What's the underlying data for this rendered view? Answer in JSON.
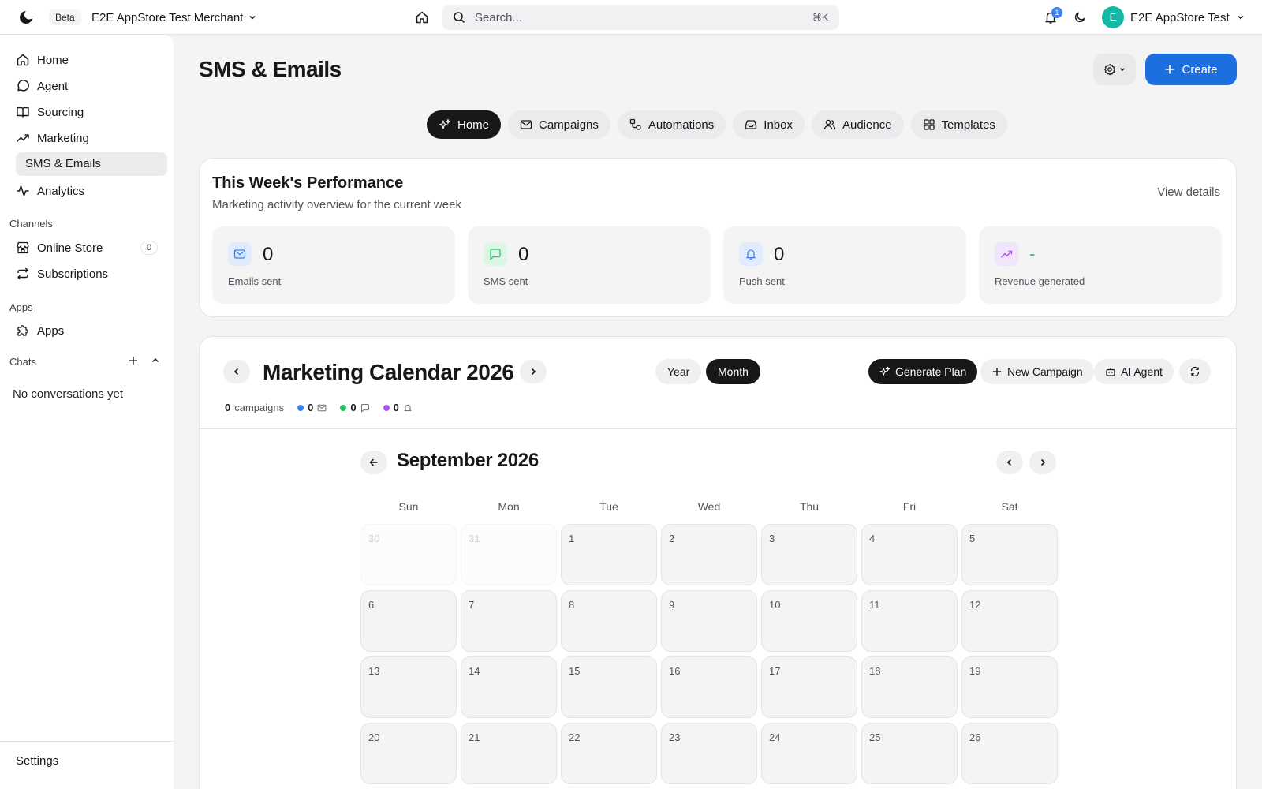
{
  "topbar": {
    "beta_label": "Beta",
    "merchant_name": "E2E AppStore Test Merchant",
    "search_placeholder": "Search...",
    "search_shortcut": "⌘K",
    "notification_count": "1",
    "user_initial": "E",
    "user_name": "E2E AppStore Test"
  },
  "sidebar": {
    "items": [
      {
        "label": "Home",
        "icon": "home-icon"
      },
      {
        "label": "Agent",
        "icon": "chat-bubble-icon"
      },
      {
        "label": "Sourcing",
        "icon": "book-icon"
      },
      {
        "label": "Marketing",
        "icon": "trending-up-icon"
      },
      {
        "label": "SMS & Emails",
        "icon": ""
      },
      {
        "label": "Analytics",
        "icon": "activity-icon"
      }
    ],
    "channels_label": "Channels",
    "channels": [
      {
        "label": "Online Store",
        "icon": "store-icon",
        "count": "0"
      },
      {
        "label": "Subscriptions",
        "icon": "repeat-icon"
      }
    ],
    "apps_label": "Apps",
    "apps": [
      {
        "label": "Apps",
        "icon": "puzzle-icon"
      }
    ],
    "chats_label": "Chats",
    "no_conversations": "No conversations yet",
    "settings_label": "Settings"
  },
  "page": {
    "title": "SMS & Emails",
    "create_label": "Create"
  },
  "tabs": [
    {
      "label": "Home",
      "icon": "sparkles-icon",
      "active": true
    },
    {
      "label": "Campaigns",
      "icon": "mail-icon"
    },
    {
      "label": "Automations",
      "icon": "workflow-icon"
    },
    {
      "label": "Inbox",
      "icon": "inbox-icon"
    },
    {
      "label": "Audience",
      "icon": "users-icon"
    },
    {
      "label": "Templates",
      "icon": "grid-icon"
    }
  ],
  "performance": {
    "title": "This Week's Performance",
    "subtitle": "Marketing activity overview for the current week",
    "view_details": "View details",
    "stats": [
      {
        "value": "0",
        "label": "Emails sent",
        "icon": "mail-icon",
        "bg": "#e0ebfd",
        "fg": "#3b82f6"
      },
      {
        "value": "0",
        "label": "SMS sent",
        "icon": "message-square-icon",
        "bg": "#dcf5e4",
        "fg": "#22c55e"
      },
      {
        "value": "0",
        "label": "Push sent",
        "icon": "bell-icon",
        "bg": "#e0ebfd",
        "fg": "#3b82f6"
      },
      {
        "value": "-",
        "label": "Revenue generated",
        "icon": "trending-up-icon",
        "bg": "#f1e4fd",
        "fg": "#a855f7",
        "value_color": "#22c55e"
      }
    ]
  },
  "calendar": {
    "title": "Marketing Calendar 2026",
    "views": [
      {
        "label": "Year",
        "active": false
      },
      {
        "label": "Month",
        "active": true
      }
    ],
    "actions": {
      "generate_plan": "Generate Plan",
      "new_campaign": "New Campaign",
      "ai_agent": "AI Agent"
    },
    "counts": {
      "campaigns_value": "0",
      "campaigns_label": "campaigns",
      "email_count": "0",
      "sms_count": "0",
      "push_count": "0"
    },
    "colors": {
      "email": "#3b82f6",
      "sms": "#22c55e",
      "push": "#a855f7"
    },
    "month_title": "September 2026",
    "weekdays": [
      "Sun",
      "Mon",
      "Tue",
      "Wed",
      "Thu",
      "Fri",
      "Sat"
    ],
    "weeks": [
      [
        {
          "n": "30",
          "muted": true
        },
        {
          "n": "31",
          "muted": true
        },
        {
          "n": "1"
        },
        {
          "n": "2"
        },
        {
          "n": "3"
        },
        {
          "n": "4"
        },
        {
          "n": "5"
        }
      ],
      [
        {
          "n": "6"
        },
        {
          "n": "7"
        },
        {
          "n": "8"
        },
        {
          "n": "9"
        },
        {
          "n": "10"
        },
        {
          "n": "11"
        },
        {
          "n": "12"
        }
      ],
      [
        {
          "n": "13"
        },
        {
          "n": "14"
        },
        {
          "n": "15"
        },
        {
          "n": "16"
        },
        {
          "n": "17"
        },
        {
          "n": "18"
        },
        {
          "n": "19"
        }
      ],
      [
        {
          "n": "20"
        },
        {
          "n": "21"
        },
        {
          "n": "22"
        },
        {
          "n": "23"
        },
        {
          "n": "24"
        },
        {
          "n": "25"
        },
        {
          "n": "26"
        }
      ]
    ]
  }
}
